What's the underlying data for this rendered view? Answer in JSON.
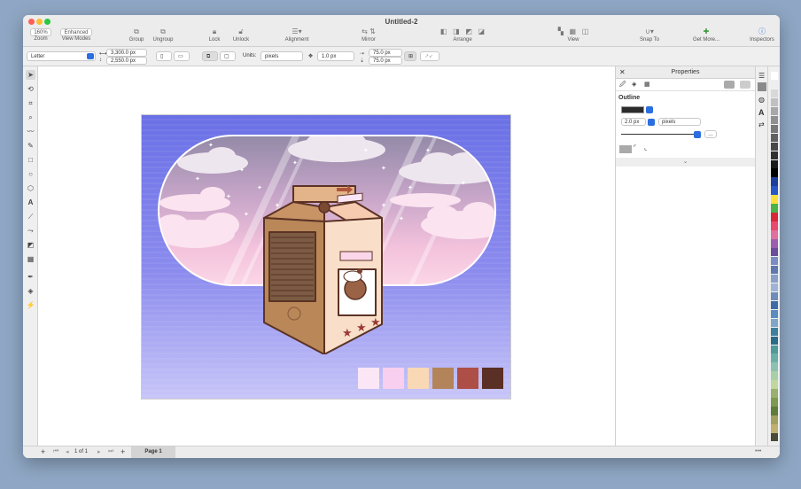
{
  "window": {
    "title": "Untitled-2"
  },
  "toolbar": {
    "zoom_value": "160%",
    "zoom_label": "Zoom",
    "view_modes_value": "Enhanced",
    "view_modes_label": "View Modes",
    "group_label": "Group",
    "ungroup_label": "Ungroup",
    "lock_label": "Lock",
    "unlock_label": "Unlock",
    "alignment_label": "Alignment",
    "mirror_label": "Mirror",
    "arrange_label": "Arrange",
    "view_label": "View",
    "snap_to_label": "Snap To",
    "get_more_label": "Get More...",
    "inspectors_label": "Inspectors"
  },
  "propbar": {
    "page_size": "Letter",
    "width": "3,300.0 px",
    "height": "2,550.0 px",
    "units_label": "Units:",
    "units_value": "pixels",
    "nudge": "1.0 px",
    "dup_x": "75.0 px",
    "dup_y": "75.0 px"
  },
  "pages": {
    "counter": "1 of 1",
    "tab": "Page 1"
  },
  "properties_panel": {
    "title": "Properties",
    "section": "Outline",
    "outline_width": "2.0 px",
    "outline_units": "pixels"
  },
  "artwork": {
    "swatches": [
      "#fbe6f5",
      "#f8cfee",
      "#f9d8b6",
      "#b38459",
      "#ad4f46",
      "#5a2f25"
    ]
  },
  "palette_colors": [
    "#ffffff",
    "#eeeeee",
    "#d8d8d8",
    "#c0c0c0",
    "#a8a8a8",
    "#909090",
    "#787878",
    "#606060",
    "#484848",
    "#303030",
    "#1a1a1a",
    "#000000",
    "#1d3f9c",
    "#2a56c8",
    "#ffe03a",
    "#49b348",
    "#d9263b",
    "#e74a6e",
    "#e0709f",
    "#9c5fb0",
    "#6b4c9a",
    "#7a8cc4",
    "#5f78b0",
    "#8aa0c8",
    "#9fb3d6",
    "#6d8cbc",
    "#3d6da8",
    "#5b8cc0",
    "#7fa6c7",
    "#3e7f9c",
    "#2c6a8a",
    "#4f9a9a",
    "#6ab0a8",
    "#8cc0b0",
    "#a8cfa8",
    "#c0d8a0",
    "#9ab070",
    "#7c9a50",
    "#5e7c3a",
    "#a0a060",
    "#c0b070",
    "#4a4a3a"
  ]
}
